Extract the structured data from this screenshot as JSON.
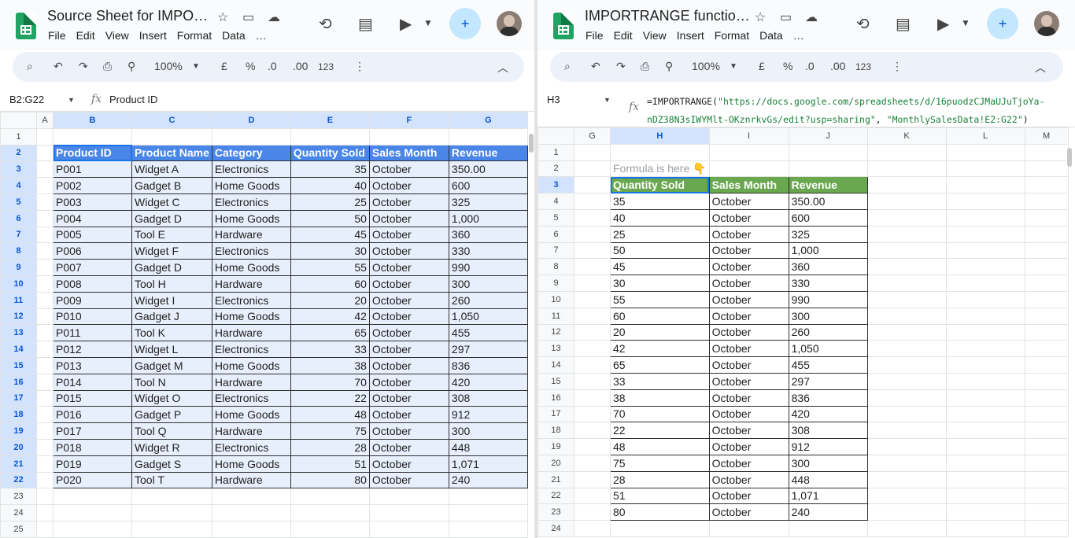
{
  "left": {
    "title": "Source Sheet for IMPO…",
    "menu": [
      "File",
      "Edit",
      "View",
      "Insert",
      "Format",
      "Data",
      "…"
    ],
    "toolbar": {
      "zoom": "100%",
      "currency": "£",
      "percent": "%",
      "dec_less": ".0",
      "dec_more": ".00",
      "numfmt": "123"
    },
    "name_box": "B2:G22",
    "formula": "Product ID",
    "columns": [
      "A",
      "B",
      "C",
      "D",
      "E",
      "F",
      "G"
    ],
    "header": [
      "Product ID",
      "Product Name",
      "Category",
      "Quantity Sold",
      "Sales Month",
      "Revenue"
    ],
    "rows": [
      [
        "P001",
        "Widget A",
        "Electronics",
        "35",
        "October",
        "350.00"
      ],
      [
        "P002",
        "Gadget B",
        "Home Goods",
        "40",
        "October",
        "600"
      ],
      [
        "P003",
        "Widget C",
        "Electronics",
        "25",
        "October",
        "325"
      ],
      [
        "P004",
        "Gadget D",
        "Home Goods",
        "50",
        "October",
        "1,000"
      ],
      [
        "P005",
        "Tool E",
        "Hardware",
        "45",
        "October",
        "360"
      ],
      [
        "P006",
        "Widget F",
        "Electronics",
        "30",
        "October",
        "330"
      ],
      [
        "P007",
        "Gadget D",
        "Home Goods",
        "55",
        "October",
        "990"
      ],
      [
        "P008",
        "Tool H",
        "Hardware",
        "60",
        "October",
        "300"
      ],
      [
        "P009",
        "Widget I",
        "Electronics",
        "20",
        "October",
        "260"
      ],
      [
        "P010",
        "Gadget J",
        "Home Goods",
        "42",
        "October",
        "1,050"
      ],
      [
        "P011",
        "Tool K",
        "Hardware",
        "65",
        "October",
        "455"
      ],
      [
        "P012",
        "Widget L",
        "Electronics",
        "33",
        "October",
        "297"
      ],
      [
        "P013",
        "Gadget M",
        "Home Goods",
        "38",
        "October",
        "836"
      ],
      [
        "P014",
        "Tool N",
        "Hardware",
        "70",
        "October",
        "420"
      ],
      [
        "P015",
        "Widget O",
        "Electronics",
        "22",
        "October",
        "308"
      ],
      [
        "P016",
        "Gadget P",
        "Home Goods",
        "48",
        "October",
        "912"
      ],
      [
        "P017",
        "Tool Q",
        "Hardware",
        "75",
        "October",
        "300"
      ],
      [
        "P018",
        "Widget R",
        "Electronics",
        "28",
        "October",
        "448"
      ],
      [
        "P019",
        "Gadget S",
        "Home Goods",
        "51",
        "October",
        "1,071"
      ],
      [
        "P020",
        "Tool T",
        "Hardware",
        "80",
        "October",
        "240"
      ]
    ],
    "row_numbers": [
      "1",
      "2",
      "3",
      "4",
      "5",
      "6",
      "7",
      "8",
      "9",
      "10",
      "11",
      "12",
      "13",
      "14",
      "15",
      "16",
      "17",
      "18",
      "19",
      "20",
      "21",
      "22",
      "23",
      "24",
      "25"
    ]
  },
  "right": {
    "title": "IMPORTRANGE functio…",
    "menu": [
      "File",
      "Edit",
      "View",
      "Insert",
      "Format",
      "Data",
      "…"
    ],
    "toolbar": {
      "zoom": "100%",
      "currency": "£",
      "percent": "%",
      "dec_less": ".0",
      "dec_more": ".00",
      "numfmt": "123"
    },
    "name_box": "H3",
    "formula_parts": {
      "fn_open": "=IMPORTRANGE(",
      "url_line1": "\"https://docs.google.com/spreadsheets/d/16puodzCJMaUJuTjoYa-",
      "url_line2": "nDZ38N3sIWYMlt-OKznrkvGs/edit?usp=sharing\"",
      "separator": ", ",
      "range": "\"MonthlySalesData!E2:G22\"",
      "close": ")"
    },
    "columns": [
      "G",
      "H",
      "I",
      "J",
      "K",
      "L",
      "M"
    ],
    "note": "Formula is here 👇",
    "header": [
      "Quantity Sold",
      "Sales Month",
      "Revenue"
    ],
    "rows": [
      [
        "35",
        "October",
        "350.00"
      ],
      [
        "40",
        "October",
        "600"
      ],
      [
        "25",
        "October",
        "325"
      ],
      [
        "50",
        "October",
        "1,000"
      ],
      [
        "45",
        "October",
        "360"
      ],
      [
        "30",
        "October",
        "330"
      ],
      [
        "55",
        "October",
        "990"
      ],
      [
        "60",
        "October",
        "300"
      ],
      [
        "20",
        "October",
        "260"
      ],
      [
        "42",
        "October",
        "1,050"
      ],
      [
        "65",
        "October",
        "455"
      ],
      [
        "33",
        "October",
        "297"
      ],
      [
        "38",
        "October",
        "836"
      ],
      [
        "70",
        "October",
        "420"
      ],
      [
        "22",
        "October",
        "308"
      ],
      [
        "48",
        "October",
        "912"
      ],
      [
        "75",
        "October",
        "300"
      ],
      [
        "28",
        "October",
        "448"
      ],
      [
        "51",
        "October",
        "1,071"
      ],
      [
        "80",
        "October",
        "240"
      ]
    ],
    "row_numbers": [
      "1",
      "2",
      "3",
      "4",
      "5",
      "6",
      "7",
      "8",
      "9",
      "10",
      "11",
      "12",
      "13",
      "14",
      "15",
      "16",
      "17",
      "18",
      "19",
      "20",
      "21",
      "22",
      "23",
      "24"
    ]
  },
  "colors": {
    "source_header": "#4a86e8",
    "source_fill": "#e8effc",
    "target_header": "#6aa84f",
    "selection": "#1a73e8"
  }
}
